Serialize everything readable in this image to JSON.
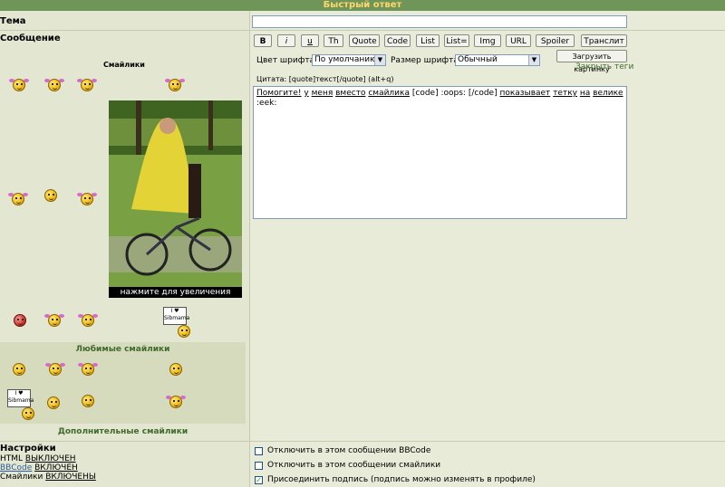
{
  "title": "Быстрый ответ",
  "fields": {
    "subject_label": "Тема",
    "subject_value": "",
    "message_label": "Сообщение"
  },
  "smilies": {
    "heading": "Смайлики",
    "photo_caption": "нажмите для увеличения",
    "sign_text": "I ♥ Sibmama",
    "favorite_label": "Любимые смайлики",
    "more_label": "Дополнительные смайлики"
  },
  "toolbar": {
    "buttons": [
      "B",
      "i",
      "u",
      "Th",
      "Quote",
      "Code",
      "List",
      "List=",
      "Img",
      "URL",
      "Spoiler",
      "Транслит"
    ],
    "font_color_label": "Цвет шрифта:",
    "font_color_value": "По умолчанию",
    "font_size_label": "Размер шрифта:",
    "font_size_value": "Обычный",
    "upload_button": "Загрузить картинку",
    "close_tags": "Закрыть теги",
    "quote_hint": "Цитата: [quote]текст[/quote]  (alt+q)"
  },
  "message": {
    "words": [
      "Помогите!",
      "у",
      "меня",
      "вместо",
      "смайлика",
      "[code]",
      ":oops:",
      "[/code]",
      "показывает",
      "тетку",
      "на",
      "велике",
      ":eek:"
    ],
    "underlined": [
      true,
      true,
      true,
      true,
      true,
      false,
      false,
      false,
      true,
      true,
      true,
      true,
      false
    ]
  },
  "settings": {
    "heading": "Настройки",
    "html_label": "HTML",
    "html_value": "ВЫКЛЮЧЕН",
    "bbcode_label": "BBCode",
    "bbcode_value": "ВКЛЮЧЕН",
    "smilies_label": "Смайлики",
    "smilies_value": "ВКЛЮЧЕНЫ"
  },
  "options": [
    {
      "label": "Отключить в этом сообщении BBCode",
      "checked": false
    },
    {
      "label": "Отключить в этом сообщении смайлики",
      "checked": false
    },
    {
      "label": "Присоединить подпись (подпись можно изменять в профиле)",
      "checked": true
    }
  ],
  "colors": {
    "title_bg": "#6f9558",
    "title_text": "#ffd86b",
    "accent_green": "#3f6a2c"
  }
}
